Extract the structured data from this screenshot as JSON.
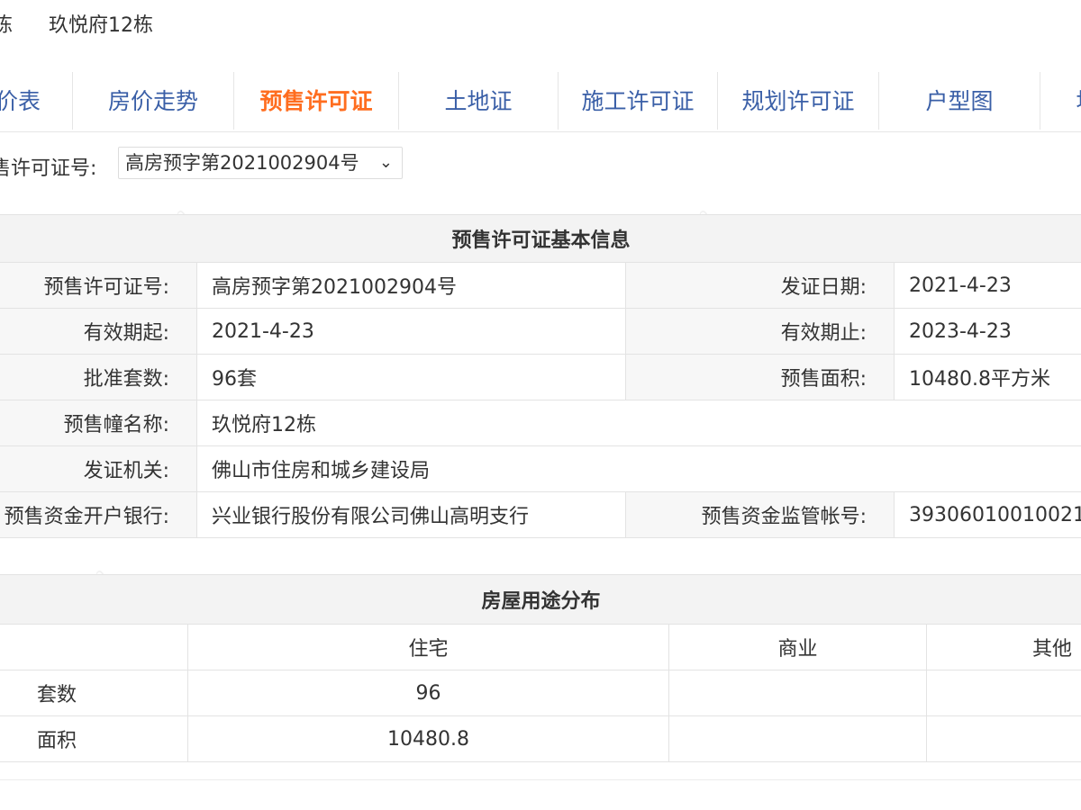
{
  "breadcrumb": {
    "prev": "栋",
    "current": "玖悦府12栋"
  },
  "tabs": [
    {
      "label": "价表"
    },
    {
      "label": "房价走势"
    },
    {
      "label": "预售许可证",
      "active": true
    },
    {
      "label": "土地证"
    },
    {
      "label": "施工许可证"
    },
    {
      "label": "规划许可证"
    },
    {
      "label": "户型图"
    },
    {
      "label": "地"
    }
  ],
  "permit_selector": {
    "label": "售许可证号:",
    "selected": "高房预字第2021002904号"
  },
  "basic_info": {
    "title": "预售许可证基本信息",
    "rows": [
      {
        "l1": "预售许可证号:",
        "v1": "高房预字第2021002904号",
        "l2": "发证日期:",
        "v2": "2021-4-23"
      },
      {
        "l1": "有效期起:",
        "v1": "2021-4-23",
        "l2": "有效期止:",
        "v2": "2023-4-23"
      },
      {
        "l1": "批准套数:",
        "v1": "96套",
        "l2": "预售面积:",
        "v2": "10480.8平方米"
      },
      {
        "l1": "预售幢名称:",
        "v1": "玖悦府12栋"
      },
      {
        "l1": "发证机关:",
        "v1": "佛山市住房和城乡建设局"
      },
      {
        "l1": "预售资金开户银行:",
        "v1": "兴业银行股份有限公司佛山高明支行",
        "l2": "预售资金监管帐号:",
        "v2": "39306010010021"
      }
    ]
  },
  "usage": {
    "title": "房屋用途分布",
    "columns": [
      "住宅",
      "商业",
      "其他"
    ],
    "rows": [
      {
        "label": "套数",
        "values": [
          "96",
          "",
          ""
        ]
      },
      {
        "label": "面积",
        "values": [
          "10480.8",
          "",
          ""
        ]
      }
    ]
  },
  "colors": {
    "tab_text": "#3a5fa7",
    "tab_active": "#ff6d1f",
    "header_bg": "#f3f3f3"
  }
}
